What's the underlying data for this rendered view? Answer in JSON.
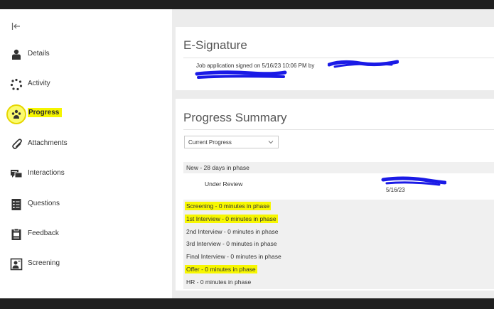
{
  "sidebar": {
    "items": [
      {
        "label": "Details",
        "icon": "person-icon"
      },
      {
        "label": "Activity",
        "icon": "activity-spinner-icon"
      },
      {
        "label": "Progress",
        "icon": "progress-icon",
        "active": true
      },
      {
        "label": "Attachments",
        "icon": "paperclip-icon"
      },
      {
        "label": "Interactions",
        "icon": "chat-icon"
      },
      {
        "label": "Questions",
        "icon": "list-icon"
      },
      {
        "label": "Feedback",
        "icon": "clipboard-icon"
      },
      {
        "label": "Screening",
        "icon": "screening-icon"
      }
    ]
  },
  "esignature": {
    "title": "E-Signature",
    "text": "Job application signed on 5/16/23 10:06 PM by"
  },
  "progress": {
    "title": "Progress Summary",
    "select_value": "Current Progress",
    "phases": [
      {
        "label": "New - 28 days in phase"
      },
      {
        "label": "Screening - 0 minutes in phase",
        "highlighted": true
      },
      {
        "label": "1st Interview - 0 minutes in phase",
        "highlighted": true
      },
      {
        "label": "2nd Interview - 0 minutes in phase"
      },
      {
        "label": "3rd Interview - 0 minutes in phase"
      },
      {
        "label": "Final Interview - 0 minutes in phase"
      },
      {
        "label": "Offer - 0 minutes in phase",
        "highlighted": true
      },
      {
        "label": "HR - 0 minutes in phase"
      }
    ],
    "sub_status": {
      "label": "Under Review",
      "date": "5/16/23"
    }
  },
  "colors": {
    "highlight": "#f7f700",
    "redaction": "#1a1ae6",
    "panel_bg": "#ececec"
  }
}
